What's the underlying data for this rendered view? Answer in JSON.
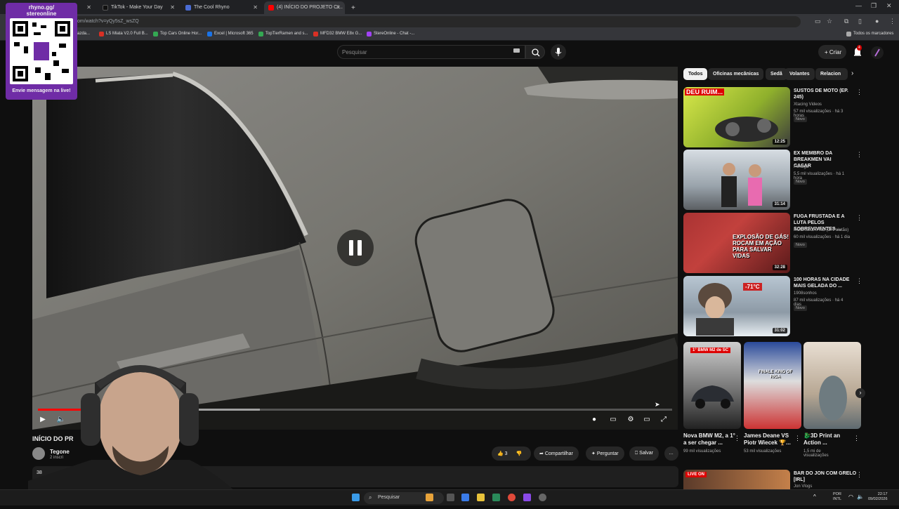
{
  "browser": {
    "tabs": [
      {
        "label": "",
        "active": false
      },
      {
        "label": "TikTok - Make Your Day",
        "active": false
      },
      {
        "label": "The Cool Rhyno",
        "active": false
      },
      {
        "label": "(4) INÍCIO DO PROJETO CI...",
        "active": true
      }
    ],
    "new_tab_label": "+",
    "url": "om/watch?v=yQy5sZ_wsZQ",
    "bookmarks": [
      {
        "label": "azda...",
        "color": "#888888"
      },
      {
        "label": "LS Miata V2.0 Full B...",
        "color": "#d93025"
      },
      {
        "label": "Top Cars Online Hor...",
        "color": "#34a853"
      },
      {
        "label": "Excel | Microsoft 365",
        "color": "#1a73e8"
      },
      {
        "label": "TopTierRamen and s...",
        "color": "#34a853"
      },
      {
        "label": "MFD32 BMW E8x G...",
        "color": "#d93025"
      },
      {
        "label": "StereOnline - Chat -...",
        "color": "#a142f4"
      }
    ],
    "all_bookmarks": "Todos os marcadores"
  },
  "youtube": {
    "search_placeholder": "Pesquisar",
    "create_label": "Criar",
    "notif_count": "4"
  },
  "player": {
    "progress_fraction": 0.24,
    "buffered_fraction": 0.35,
    "state": "paused-overlay"
  },
  "video": {
    "title": "INÍCIO DO PR",
    "title_suffix": "O",
    "channel": "Tegone",
    "subs": "2 inscri",
    "likes": "3",
    "share": "Compartilhar",
    "ask": "Perguntar",
    "save": "Salvar",
    "desc_views": "38"
  },
  "chips": [
    "Todos",
    "Oficinas mecânicas",
    "Sedã",
    "Volantes",
    "Relacion"
  ],
  "recommendations": [
    {
      "title": "SUSTOS DE MOTO (EP. 245)",
      "channel": "Xtacing Videos",
      "meta": "57 mil visualizações · há 3 horas",
      "badge": "Novo",
      "duration": "12:25",
      "thumb_text": "DEU RUIM..."
    },
    {
      "title": "EX MEMBRO DA BREAKMEN VAI CASAR",
      "channel": "Portuga",
      "meta": "5,5 mil visualizações · há 1 hora",
      "badge": "Novo",
      "duration": "31:14",
      "thumb_text": ""
    },
    {
      "title": "FUGA FRUSTADA E A LUTA PELOS SOBREVIVENTES ...",
      "channel": "ROCAM CAPÃO (2º Pelotão)",
      "meta": "60 mil visualizações · há 1 dia",
      "badge": "Novo",
      "duration": "32:28",
      "thumb_text": "EXPLOSÃO DE GÁS! ROCAM EM AÇÃO PARA SALVAR VIDAS"
    },
    {
      "title": "100 HORAS NA CIDADE MAIS GELADA DO ...",
      "channel": "1908sonhos",
      "meta": "87 mil visualizações · há 4 dias",
      "badge": "Novo",
      "duration": "31:02",
      "thumb_text": "-71°C"
    }
  ],
  "shorts": [
    {
      "title": "Nova BMW M2, a 1° a ser chegar ...",
      "views": "99 mil visualizações",
      "thumb_text": "1° BMW M2 de SC"
    },
    {
      "title": "James Deane VS Piotr Wiecek 🏆...",
      "views": "53 mil visualizações",
      "thumb_text": "FINALE KING OF RIGA"
    },
    {
      "title": "🐉3D Print an Action ...",
      "views": "1,5 mi de visualizações",
      "thumb_text": ""
    }
  ],
  "next_rec": {
    "title": "BAR DO JON COM GRELO [IRL]",
    "channel": "Jon Vlogs",
    "thumb_text": "LIVE ON"
  },
  "overlay": {
    "line1": "rhyno.gg/",
    "line2": "stereonline",
    "cta": "Envie mensagem na live!"
  },
  "taskbar": {
    "search": "Pesquisar",
    "lang1": "POR",
    "lang2": "INTL",
    "time": "22:17",
    "date": "09/02/2026"
  }
}
